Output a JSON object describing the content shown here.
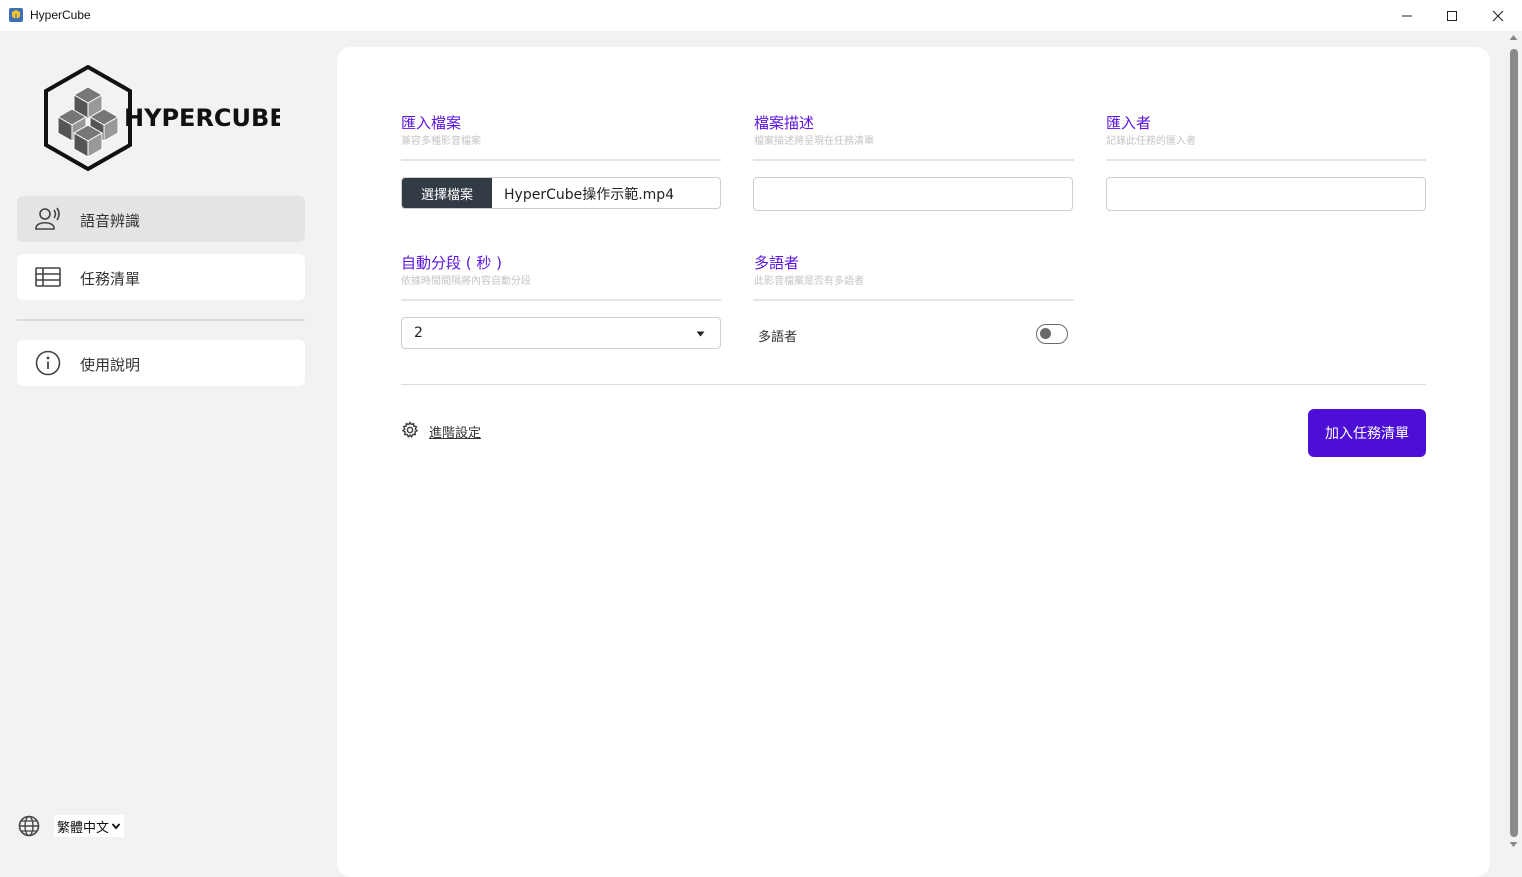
{
  "window": {
    "title": "HyperCube"
  },
  "sidebar": {
    "logo_text": "HYPERCUBE",
    "items": [
      {
        "label": "語音辨識",
        "icon": "speaker-person-icon",
        "active": true
      },
      {
        "label": "任務清單",
        "icon": "list-table-icon",
        "active": false
      },
      {
        "label": "使用說明",
        "icon": "info-icon",
        "active": false
      }
    ],
    "language": {
      "icon": "globe-icon",
      "selected": "繁體中文"
    }
  },
  "form": {
    "import_file": {
      "title": "匯入檔案",
      "subtitle": "兼容多種影音檔案",
      "button_label": "選擇檔案",
      "file_name": "HyperCube操作示範.mp4"
    },
    "description": {
      "title": "檔案描述",
      "subtitle": "檔案描述將呈現在任務清單",
      "value": ""
    },
    "importer": {
      "title": "匯入者",
      "subtitle": "記錄此任務的匯入者",
      "value": ""
    },
    "auto_segment": {
      "title": "自動分段 ( 秒 )",
      "subtitle": "依據時間間隔將內容自動分段",
      "selected": "2"
    },
    "multi_speaker": {
      "title": "多語者",
      "subtitle": "此影音檔案是否有多語者",
      "toggle_label": "多語者",
      "enabled": false
    },
    "advanced_settings_label": "進階設定",
    "submit_label": "加入任務清單"
  },
  "colors": {
    "accent": "#5c16e0",
    "primary_button": "#4d0fd6",
    "file_button": "#333b45"
  }
}
